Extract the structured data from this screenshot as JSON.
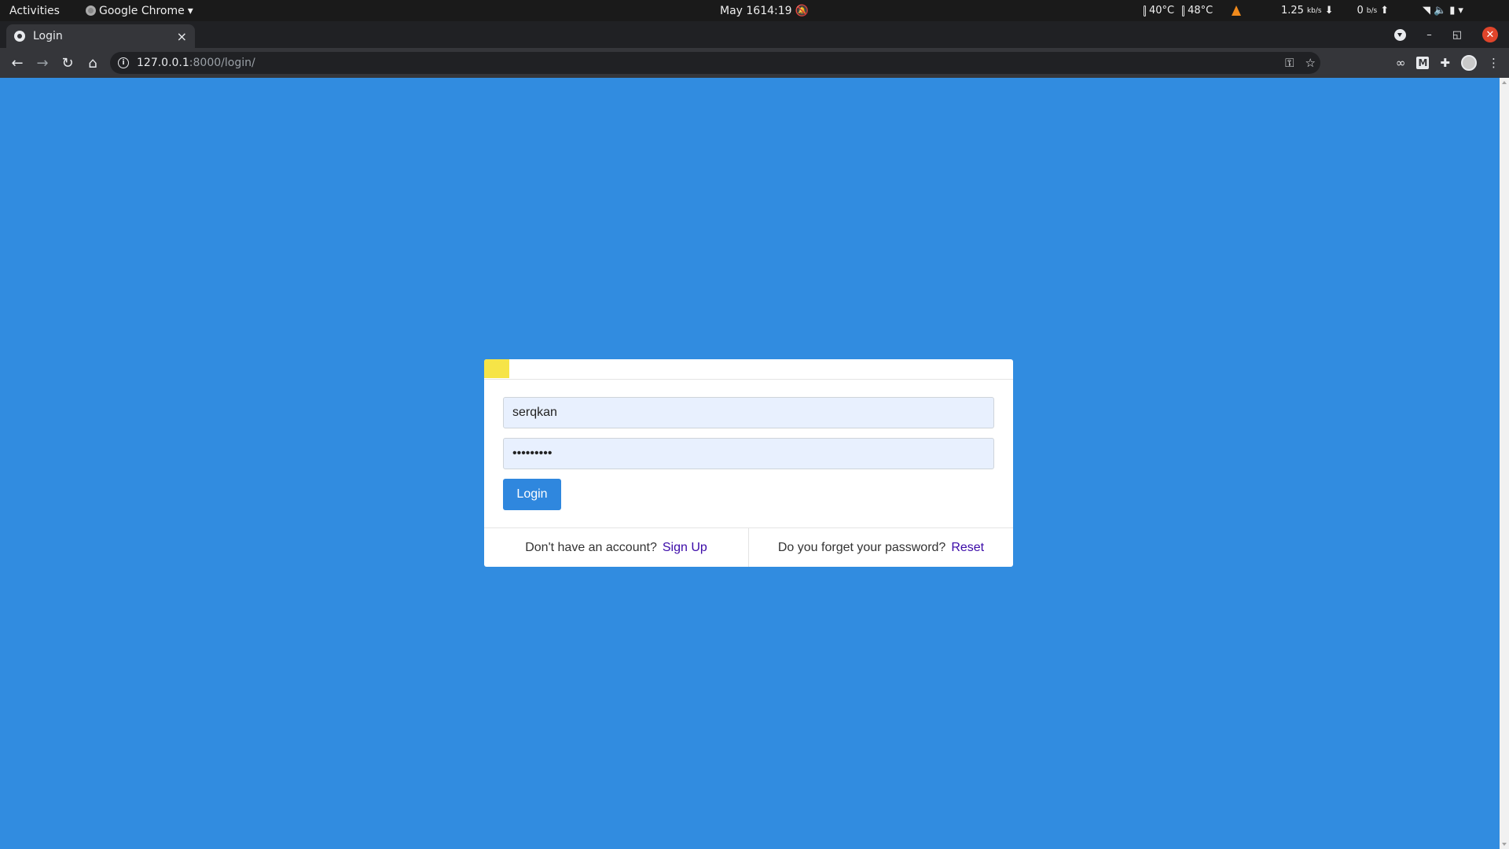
{
  "system_bar": {
    "activities": "Activities",
    "app_name": "Google Chrome",
    "date": "May 16",
    "time": "14:19",
    "temp1": "40°C",
    "temp2": "48°C",
    "net_down": "1.25",
    "net_down_unit": "kb/s",
    "net_up": "0",
    "net_up_unit": "b/s",
    "icons": [
      "notifications-off-icon",
      "vlc-icon",
      "wifi-icon",
      "volume-icon",
      "battery-icon",
      "chevron-down-icon"
    ]
  },
  "browser": {
    "tab_title": "Login",
    "tab_close": "×",
    "new_tab": "+",
    "url_host": "127.0.0.1",
    "url_path": ":8000/login/",
    "window_minimize": "–",
    "window_restore": "◱",
    "window_close": "✕"
  },
  "login_form": {
    "username_value": "serqkan",
    "password_value": "•••••••••",
    "login_label": "Login",
    "signup_prompt": "Don't have an account?",
    "signup_link": "Sign Up",
    "reset_prompt": "Do you forget your password?",
    "reset_link": "Reset"
  },
  "colors": {
    "page_background": "#318ce0",
    "button": "#2f87de",
    "link": "#3b0aa8",
    "badge": "#f6e447"
  }
}
